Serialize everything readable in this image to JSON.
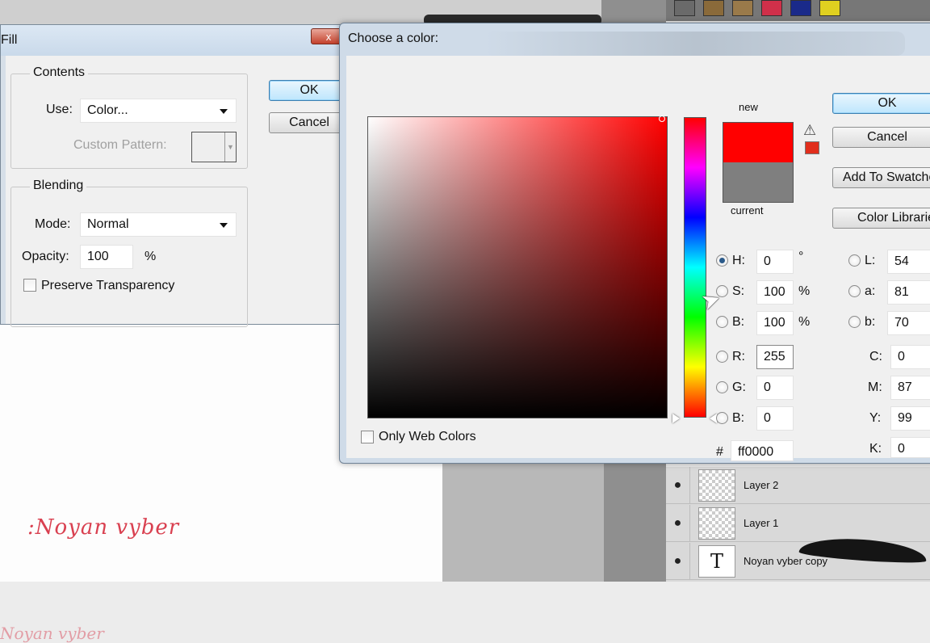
{
  "fill_dialog": {
    "title": "Fill",
    "close_label": "x",
    "ok_label": "OK",
    "cancel_label": "Cancel",
    "contents": {
      "legend": "Contents",
      "use_label": "Use:",
      "use_value": "Color...",
      "custom_pattern_label": "Custom Pattern:"
    },
    "blending": {
      "legend": "Blending",
      "mode_label": "Mode:",
      "mode_value": "Normal",
      "opacity_label": "Opacity:",
      "opacity_value": "100",
      "opacity_unit": "%",
      "preserve_label": "Preserve Transparency"
    }
  },
  "color_picker": {
    "title": "Choose a color:",
    "ok_label": "OK",
    "cancel_label": "Cancel",
    "add_swatches_label": "Add To Swatches",
    "color_libraries_label": "Color Libraries",
    "new_label": "new",
    "current_label": "current",
    "only_web_colors_label": "Only Web Colors",
    "new_color": "#ff0000",
    "current_color": "#7f7f7f",
    "hsb": {
      "h_label": "H:",
      "h_value": "0",
      "h_unit": "°",
      "s_label": "S:",
      "s_value": "100",
      "s_unit": "%",
      "b_label": "B:",
      "b_value": "100",
      "b_unit": "%"
    },
    "rgb": {
      "r_label": "R:",
      "r_value": "255",
      "g_label": "G:",
      "g_value": "0",
      "b_label": "B:",
      "b_value": "0"
    },
    "lab": {
      "l_label": "L:",
      "l_value": "54",
      "a_label": "a:",
      "a_value": "81",
      "b_label": "b:",
      "b_value": "70"
    },
    "cmyk": {
      "c_label": "C:",
      "c_value": "0",
      "m_label": "M:",
      "m_value": "87",
      "y_label": "Y:",
      "y_value": "99",
      "k_label": "K:",
      "k_value": "0"
    },
    "hex_label": "#",
    "hex_value": "ff0000"
  },
  "layers": [
    {
      "name": "Layer 2"
    },
    {
      "name": "Layer 1"
    },
    {
      "name": "Noyan vyber  copy"
    }
  ],
  "canvas": {
    "signature_text": ":Noyan vyber"
  }
}
